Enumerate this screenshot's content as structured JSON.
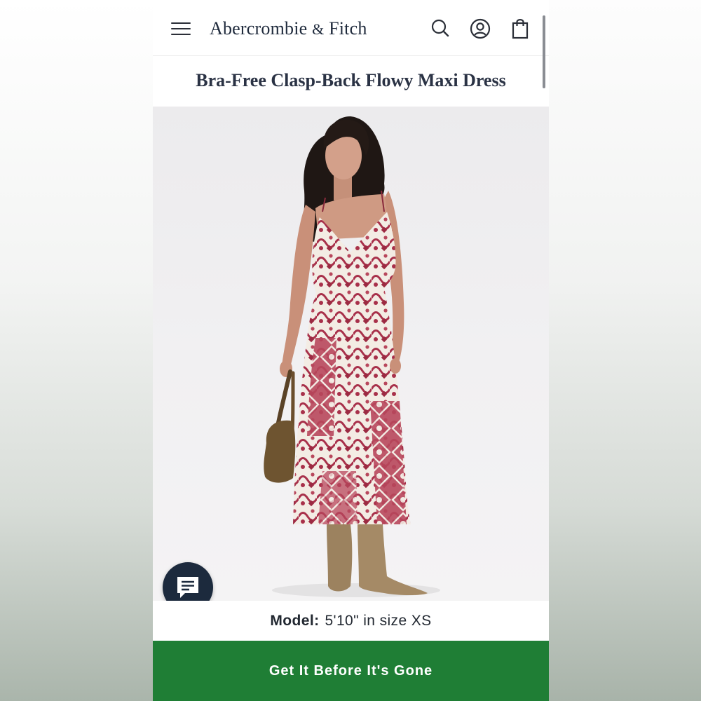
{
  "header": {
    "brand_name": "Abercrombie",
    "brand_amp": "&",
    "brand_second": "Fitch",
    "icons": [
      "menu-icon",
      "search-icon",
      "account-icon",
      "shopping-bag-icon"
    ]
  },
  "product": {
    "title": "Bra-Free Clasp-Back Flowy Maxi Dress"
  },
  "model_info": {
    "label": "Model:",
    "value": "5'10\" in size XS"
  },
  "chat": {
    "icon": "chat-icon"
  },
  "cta": {
    "label": "Get It Before It's Gone"
  },
  "colors": {
    "cta_green": "#1f7e35",
    "navy": "#1c2a3d",
    "print_red": "#a8304a",
    "print_cream": "#f3ece4"
  }
}
